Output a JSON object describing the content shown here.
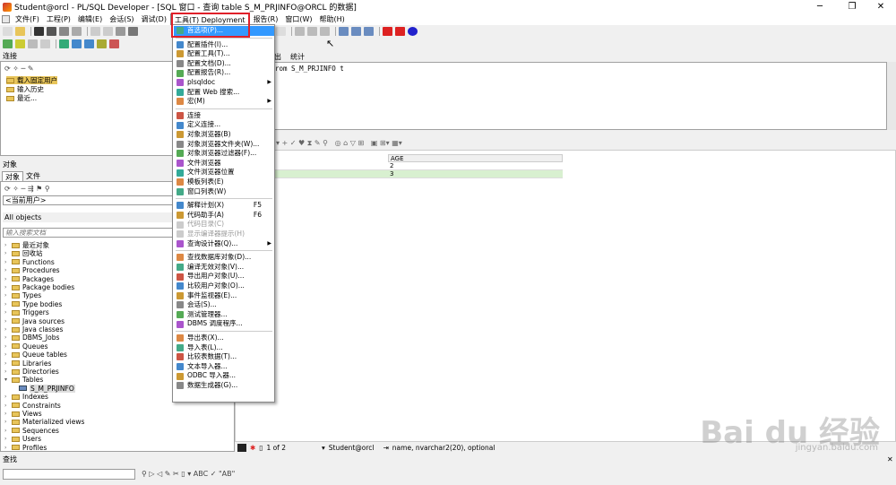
{
  "window": {
    "title": "Student@orcl - PL/SQL Developer - [SQL 窗口 - 查询 table S_M_PRJINFO@ORCL 的数据]",
    "minimize": "─",
    "maximize": "❐",
    "close": "✕"
  },
  "menubar": {
    "items": [
      {
        "label": "文件(F)"
      },
      {
        "label": "工程(P)"
      },
      {
        "label": "编辑(E)"
      },
      {
        "label": "会话(S)"
      },
      {
        "label": "调试(D)"
      },
      {
        "label": "工具(T)  Deployment"
      },
      {
        "label": "报告(R)"
      },
      {
        "label": "窗口(W)"
      },
      {
        "label": "帮助(H)"
      }
    ]
  },
  "left_panel": {
    "connection_header": "连接",
    "connection_items": [
      "载入固定用户",
      "输入历史",
      "最近..."
    ],
    "objects_header": "对象",
    "tabs": [
      "对象",
      "文件"
    ],
    "user_selector": "<当前用户>",
    "filter": "All objects",
    "search_placeholder": "输入搜索文档",
    "tree": [
      {
        "label": "最近对象",
        "expanded": false
      },
      {
        "label": "回收站",
        "expanded": false
      },
      {
        "label": "Functions",
        "expanded": false
      },
      {
        "label": "Procedures",
        "expanded": false
      },
      {
        "label": "Packages",
        "expanded": false
      },
      {
        "label": "Package bodies",
        "expanded": false
      },
      {
        "label": "Types",
        "expanded": false
      },
      {
        "label": "Type bodies",
        "expanded": false
      },
      {
        "label": "Triggers",
        "expanded": false
      },
      {
        "label": "Java sources",
        "expanded": false
      },
      {
        "label": "Java classes",
        "expanded": false
      },
      {
        "label": "DBMS_Jobs",
        "expanded": false
      },
      {
        "label": "Queues",
        "expanded": false
      },
      {
        "label": "Queue tables",
        "expanded": false
      },
      {
        "label": "Libraries",
        "expanded": false
      },
      {
        "label": "Directories",
        "expanded": false
      },
      {
        "label": "Tables",
        "expanded": true
      },
      {
        "label": "S_M_PRJINFO",
        "child": true
      },
      {
        "label": "Indexes",
        "expanded": false
      },
      {
        "label": "Constraints",
        "expanded": false
      },
      {
        "label": "Views",
        "expanded": false
      },
      {
        "label": "Materialized views",
        "expanded": false
      },
      {
        "label": "Sequences",
        "expanded": false
      },
      {
        "label": "Users",
        "expanded": false
      },
      {
        "label": "Profiles",
        "expanded": false
      }
    ]
  },
  "editor": {
    "tabs": [
      "出",
      "统计"
    ],
    "sql_text": "rom S_M_PRJINFO t"
  },
  "grid": {
    "column": "AGE",
    "rows": [
      "2",
      "3"
    ]
  },
  "statusbar": {
    "page": "1 of 2",
    "connection": "Student@orcl",
    "column_info": "name, nvarchar2(20), optional"
  },
  "find": {
    "header": "查找",
    "input_value": ""
  },
  "tools_menu": {
    "items": [
      {
        "label": "首选项(P)...",
        "highlighted": true
      },
      {
        "sep": true
      },
      {
        "label": "配置插件(I)..."
      },
      {
        "label": "配置工具(T)..."
      },
      {
        "label": "配置文档(D)..."
      },
      {
        "label": "配置报告(R)..."
      },
      {
        "label": "plsqldoc",
        "submenu": true
      },
      {
        "label": "配置 Web 搜索..."
      },
      {
        "label": "宏(M)",
        "submenu": true
      },
      {
        "sep": true
      },
      {
        "label": "连接"
      },
      {
        "label": "定义连接..."
      },
      {
        "label": "对象浏览器(B)"
      },
      {
        "label": "对象浏览器文件夹(W)..."
      },
      {
        "label": "对象浏览器过滤器(F)..."
      },
      {
        "label": "文件浏览器"
      },
      {
        "label": "文件浏览器位置"
      },
      {
        "label": "模板列表(E)"
      },
      {
        "label": "窗口列表(W)"
      },
      {
        "sep": true
      },
      {
        "label": "解释计划(X)",
        "shortcut": "F5"
      },
      {
        "label": "代码助手(A)",
        "shortcut": "F6"
      },
      {
        "label": "代码目录(C)",
        "disabled": true
      },
      {
        "label": "显示编译器提示(H)",
        "disabled": true
      },
      {
        "label": "查询设计器(Q)...",
        "submenu": true
      },
      {
        "sep": true
      },
      {
        "label": "查找数据库对象(D)..."
      },
      {
        "label": "编译无效对象(V)..."
      },
      {
        "label": "导出用户对象(U)..."
      },
      {
        "label": "比较用户对象(O)..."
      },
      {
        "label": "事件监视器(E)..."
      },
      {
        "label": "会话(S)..."
      },
      {
        "label": "测试管理器..."
      },
      {
        "label": "DBMS 调度程序..."
      },
      {
        "sep": true
      },
      {
        "label": "导出表(X)..."
      },
      {
        "label": "导入表(L)..."
      },
      {
        "label": "比较表数据(T)..."
      },
      {
        "label": "文本导入器..."
      },
      {
        "label": "ODBC 导入器..."
      },
      {
        "label": "数据生成器(G)..."
      }
    ]
  },
  "watermark": {
    "brand": "Bai du 经验",
    "url": "jingyan.baidu.com"
  },
  "colors": {
    "highlight": "#3399ff",
    "annotation_red": "#e0202a"
  }
}
